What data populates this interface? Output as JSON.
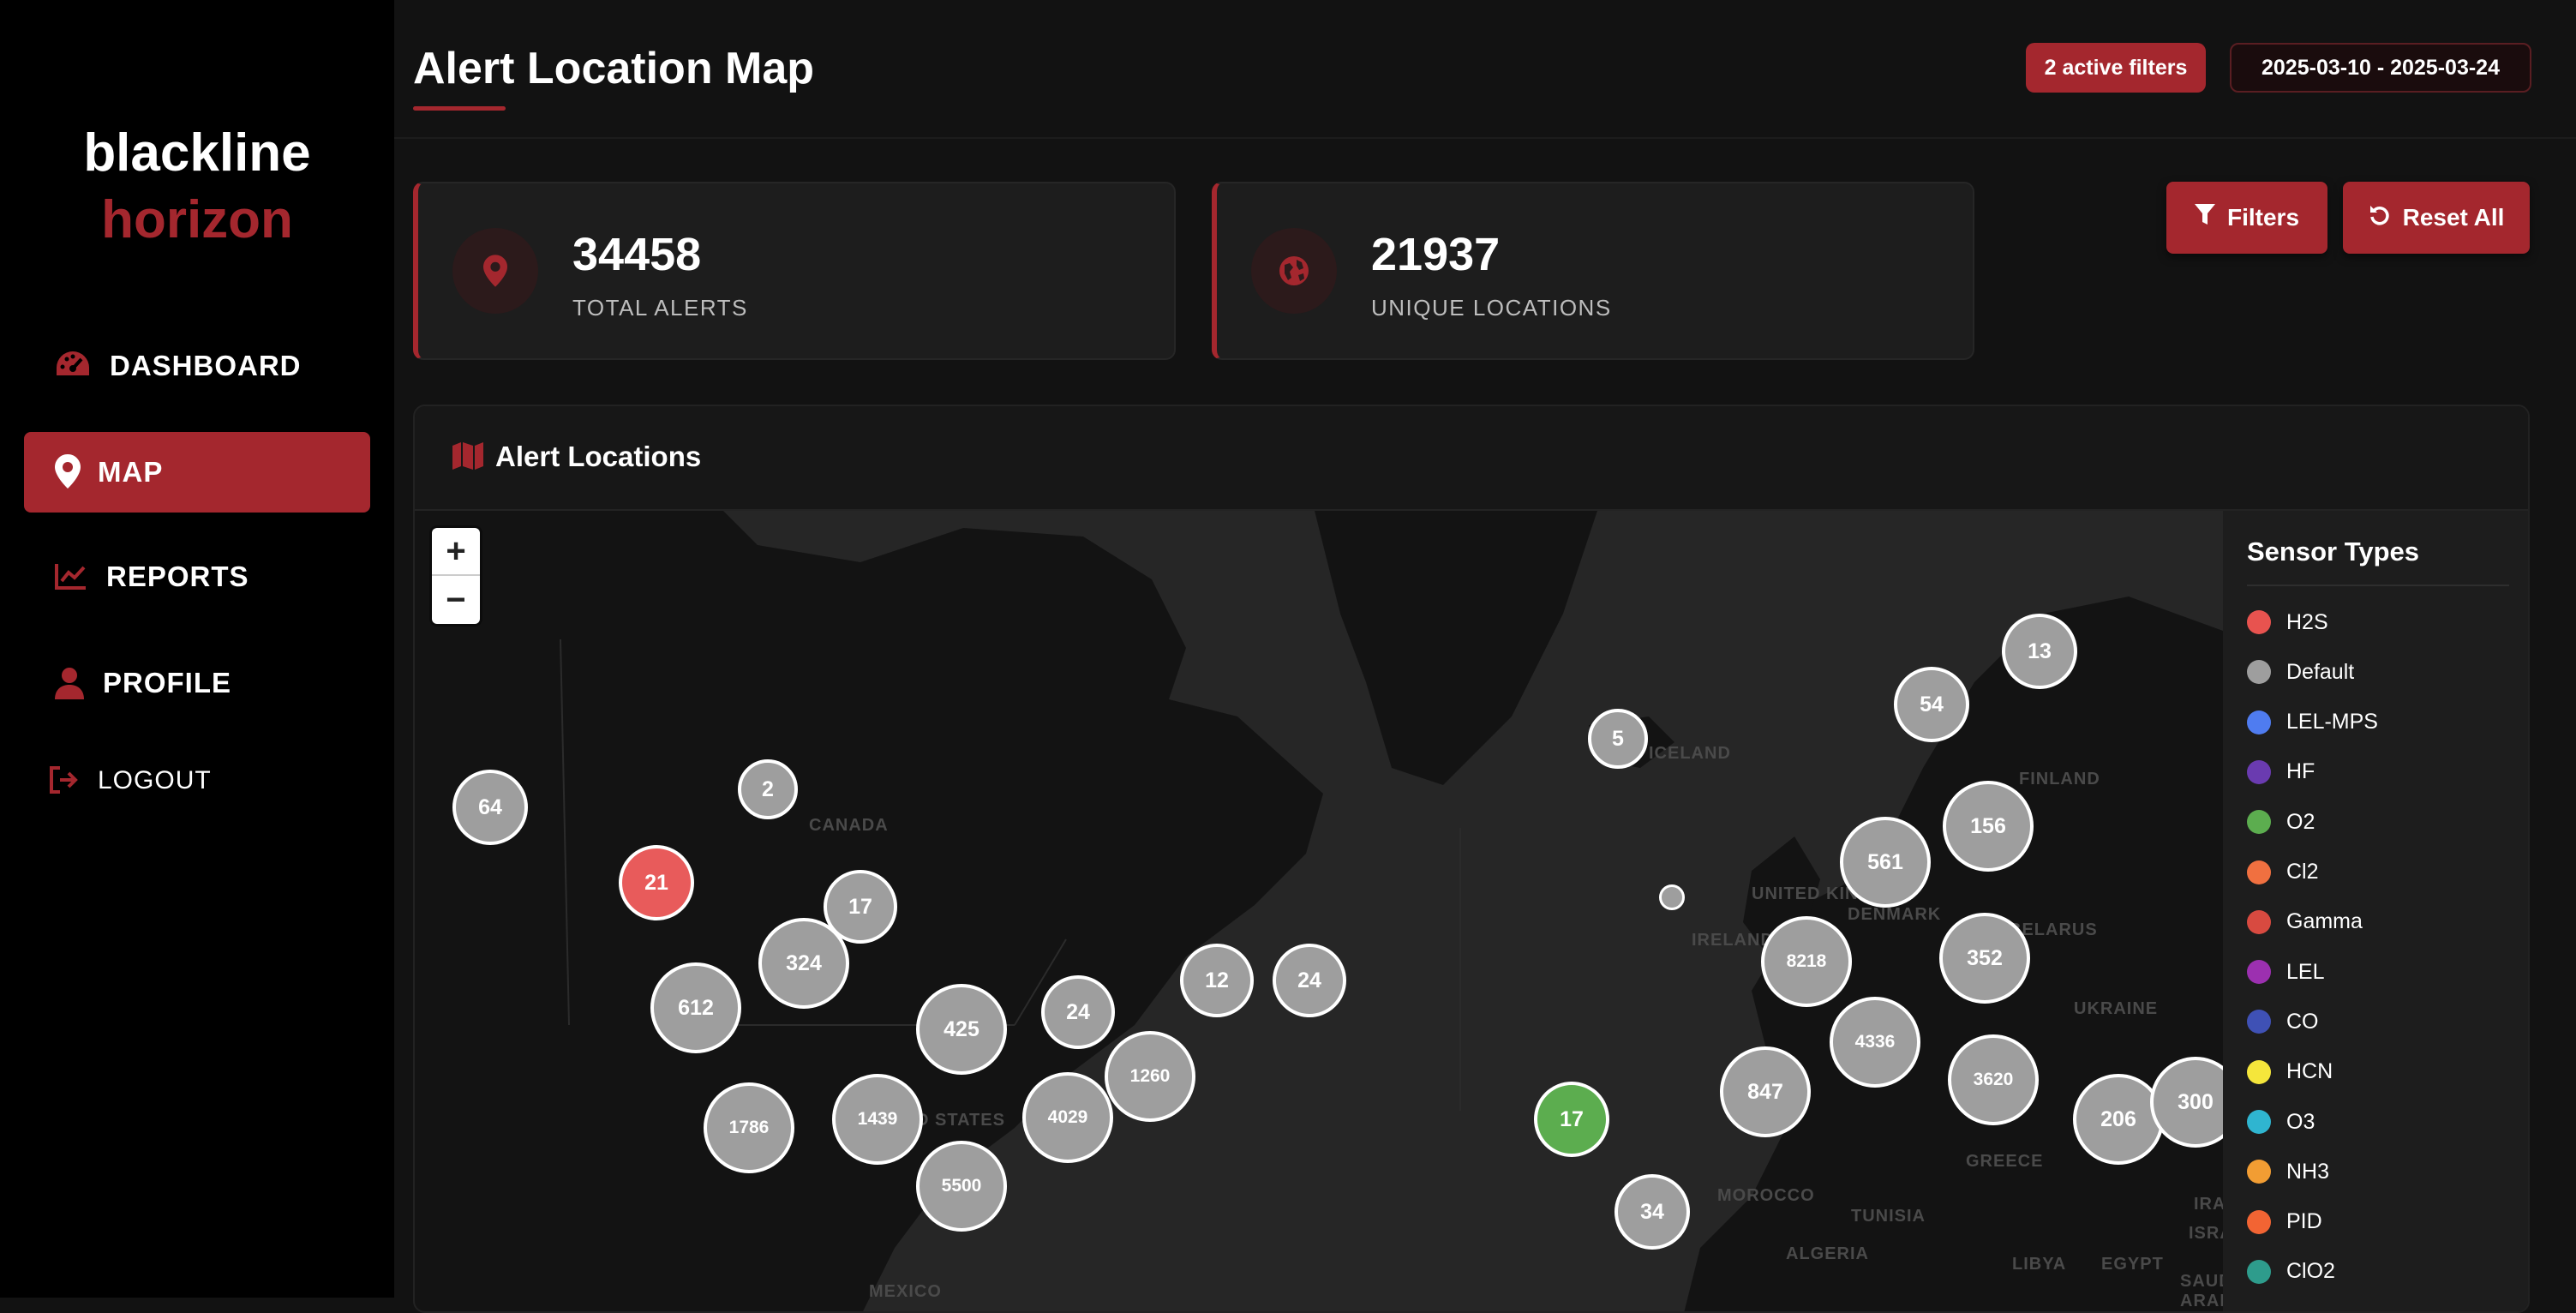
{
  "brand": {
    "line1": "blackline",
    "line2": "horizon"
  },
  "nav": {
    "dashboard": "DASHBOARD",
    "map": "MAP",
    "reports": "REPORTS",
    "profile": "PROFILE",
    "logout": "LOGOUT"
  },
  "header": {
    "title": "Alert Location Map",
    "active_filters": "2 active filters",
    "date_range": "2025-03-10 - 2025-03-24"
  },
  "stats": {
    "total_alerts": {
      "value": "34458",
      "label": "TOTAL ALERTS"
    },
    "unique_locations": {
      "value": "21937",
      "label": "UNIQUE LOCATIONS"
    }
  },
  "actions": {
    "filters": "Filters",
    "reset": "Reset All"
  },
  "panel": {
    "title": "Alert Locations"
  },
  "map": {
    "zoom_in": "+",
    "zoom_out": "−",
    "labels": [
      "CANADA",
      "UNITED STATES",
      "MEXICO",
      "DENMARK",
      "UNITED KINGDOM",
      "IRELAND",
      "BELARUS",
      "UKRAINE",
      "GREECE",
      "TUNISIA",
      "MOROCCO",
      "ALGERIA",
      "LIBYA",
      "EGYPT",
      "ISRAEL",
      "IRAQ",
      "SAUDI ARABIA",
      "FINLAND",
      "ICELAND"
    ],
    "clusters": [
      {
        "count": "64",
        "color": "#9e9e9e"
      },
      {
        "count": "2",
        "color": "#9e9e9e"
      },
      {
        "count": "21",
        "color": "#e85b5b"
      },
      {
        "count": "17",
        "color": "#9e9e9e"
      },
      {
        "count": "324",
        "color": "#9e9e9e"
      },
      {
        "count": "612",
        "color": "#9e9e9e"
      },
      {
        "count": "425",
        "color": "#9e9e9e"
      },
      {
        "count": "24",
        "color": "#9e9e9e"
      },
      {
        "count": "12",
        "color": "#9e9e9e"
      },
      {
        "count": "24",
        "color": "#9e9e9e"
      },
      {
        "count": "1260",
        "color": "#9e9e9e"
      },
      {
        "count": "4029",
        "color": "#9e9e9e"
      },
      {
        "count": "1786",
        "color": "#9e9e9e"
      },
      {
        "count": "1439",
        "color": "#9e9e9e"
      },
      {
        "count": "5500",
        "color": "#9e9e9e"
      },
      {
        "count": "5",
        "color": "#9e9e9e"
      },
      {
        "count": "17",
        "color": "#5cad4f"
      },
      {
        "count": "34",
        "color": "#9e9e9e"
      },
      {
        "count": "847",
        "color": "#9e9e9e"
      },
      {
        "count": "54",
        "color": "#9e9e9e"
      },
      {
        "count": "13",
        "color": "#9e9e9e"
      },
      {
        "count": "561",
        "color": "#9e9e9e"
      },
      {
        "count": "156",
        "color": "#9e9e9e"
      },
      {
        "count": "8218",
        "color": "#9e9e9e"
      },
      {
        "count": "352",
        "color": "#9e9e9e"
      },
      {
        "count": "4336",
        "color": "#9e9e9e"
      },
      {
        "count": "3620",
        "color": "#9e9e9e"
      },
      {
        "count": "206",
        "color": "#9e9e9e"
      },
      {
        "count": "300",
        "color": "#9e9e9e"
      }
    ]
  },
  "legend": {
    "title": "Sensor Types",
    "items": [
      {
        "label": "H2S",
        "color": "#e8534f"
      },
      {
        "label": "Default",
        "color": "#9e9e9e"
      },
      {
        "label": "LEL-MPS",
        "color": "#4f7cf0"
      },
      {
        "label": "HF",
        "color": "#6a3bb0"
      },
      {
        "label": "O2",
        "color": "#5cad4f"
      },
      {
        "label": "Cl2",
        "color": "#f07040"
      },
      {
        "label": "Gamma",
        "color": "#d84a40"
      },
      {
        "label": "LEL",
        "color": "#9c30b0"
      },
      {
        "label": "CO",
        "color": "#3f51b5"
      },
      {
        "label": "HCN",
        "color": "#f5e63b"
      },
      {
        "label": "O3",
        "color": "#2fb5d0"
      },
      {
        "label": "NH3",
        "color": "#f29d33"
      },
      {
        "label": "PID",
        "color": "#f26433"
      },
      {
        "label": "ClO2",
        "color": "#2e9c8c"
      }
    ]
  },
  "colors": {
    "accent": "#a4272e"
  }
}
